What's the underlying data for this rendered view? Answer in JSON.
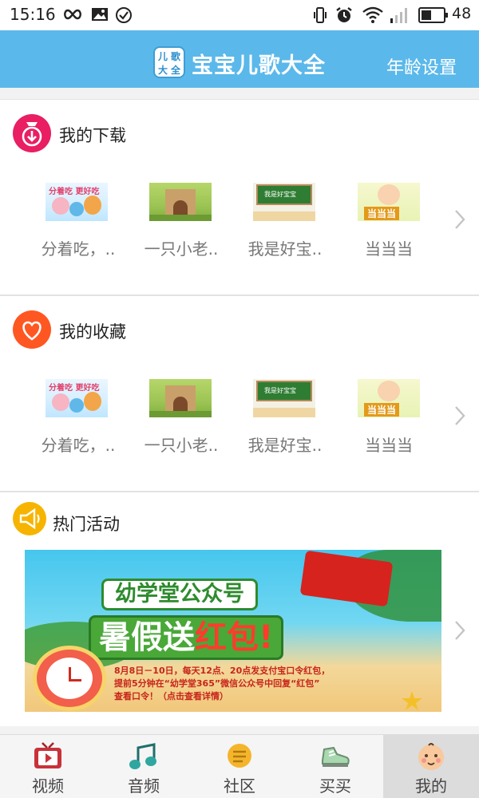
{
  "status_bar": {
    "time": "15:16",
    "battery_percent": "48",
    "battery_level": 0.48
  },
  "header": {
    "logo_text": [
      "儿",
      "歌",
      "大",
      "全"
    ],
    "title": "宝宝儿歌大全",
    "age_setting": "年龄设置"
  },
  "downloads": {
    "title": "我的下载",
    "items": [
      {
        "caption": "分着吃，..",
        "thumb_text": "分着吃 更好吃"
      },
      {
        "caption": "一只小老.."
      },
      {
        "caption": "我是好宝..",
        "thumb_text": "我是好宝宝"
      },
      {
        "caption": "当当当",
        "thumb_text": "当当当"
      }
    ]
  },
  "favorites": {
    "title": "我的收藏",
    "items": [
      {
        "caption": "分着吃，..",
        "thumb_text": "分着吃 更好吃"
      },
      {
        "caption": "一只小老.."
      },
      {
        "caption": "我是好宝..",
        "thumb_text": "我是好宝宝"
      },
      {
        "caption": "当当当",
        "thumb_text": "当当当"
      }
    ]
  },
  "events": {
    "title": "热门活动",
    "banner": {
      "headline": "幼学堂公众号",
      "main_text_1": "暑假送",
      "main_text_2": "红包!",
      "line1": "8月8日－10日，每天12点、20点发支付宝口令红包，",
      "line2": "提前5分钟在“幼学堂365”微信公众号中回复“红包”",
      "line3": "查看口令！（点击查看详情）"
    }
  },
  "tabs": [
    {
      "label": "视频",
      "icon": "tv-icon",
      "active": false
    },
    {
      "label": "音频",
      "icon": "music-note-icon",
      "active": false
    },
    {
      "label": "社区",
      "icon": "chat-bubble-icon",
      "active": false
    },
    {
      "label": "买买",
      "icon": "shoe-icon",
      "active": false
    },
    {
      "label": "我的",
      "icon": "baby-face-icon",
      "active": true
    }
  ],
  "colors": {
    "header_bg": "#5bb8ea",
    "download_icon": "#e91e63",
    "favorite_icon": "#ff5722",
    "event_icon": "#f6b400"
  }
}
